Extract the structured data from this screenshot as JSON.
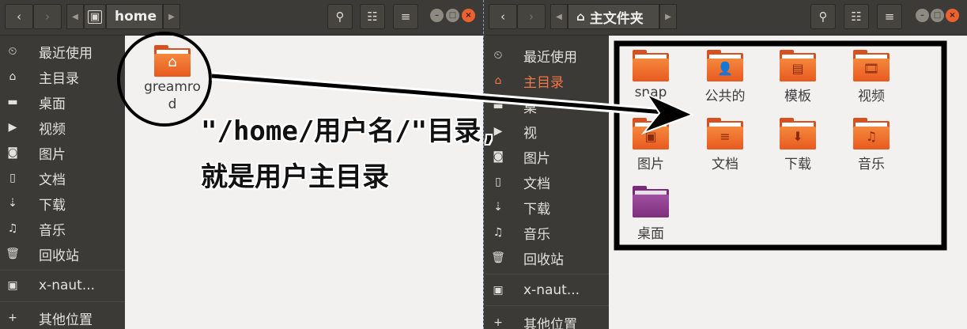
{
  "left_window": {
    "path": {
      "icon": "home-folder-icon",
      "label": "home"
    },
    "sidebar": [
      {
        "icon": "clock-icon",
        "glyph": "⏲",
        "label": "最近使用"
      },
      {
        "icon": "home-icon",
        "glyph": "⌂",
        "label": "主目录"
      },
      {
        "icon": "folder-icon",
        "glyph": "▬",
        "label": "桌面"
      },
      {
        "icon": "video-icon",
        "glyph": "▶",
        "label": "视频"
      },
      {
        "icon": "camera-icon",
        "glyph": "◙",
        "label": "图片"
      },
      {
        "icon": "document-icon",
        "glyph": "▯",
        "label": "文档"
      },
      {
        "icon": "download-icon",
        "glyph": "⇣",
        "label": "下载"
      },
      {
        "icon": "music-icon",
        "glyph": "♫",
        "label": "音乐"
      },
      {
        "icon": "trash-icon",
        "glyph": "🗑",
        "label": "回收站"
      },
      {
        "icon": "network-drive-icon",
        "glyph": "▣",
        "label": "x-naut..."
      },
      {
        "icon": "plus-icon",
        "glyph": "+",
        "label": "其他位置"
      }
    ],
    "items": [
      {
        "label_line1": "greamro",
        "label_line2": "d"
      }
    ]
  },
  "right_window": {
    "path": {
      "icon": "home-icon",
      "label": "主文件夹"
    },
    "sidebar": [
      {
        "icon": "clock-icon",
        "glyph": "⏲",
        "label": "最近使用"
      },
      {
        "icon": "home-icon",
        "glyph": "⌂",
        "label": "主目录",
        "active": true
      },
      {
        "icon": "folder-icon",
        "glyph": "▬",
        "label": "桌"
      },
      {
        "icon": "video-icon",
        "glyph": "▶",
        "label": "视"
      },
      {
        "icon": "camera-icon",
        "glyph": "◙",
        "label": "图片"
      },
      {
        "icon": "document-icon",
        "glyph": "▯",
        "label": "文档"
      },
      {
        "icon": "download-icon",
        "glyph": "⇣",
        "label": "下载"
      },
      {
        "icon": "music-icon",
        "glyph": "♫",
        "label": "音乐"
      },
      {
        "icon": "trash-icon",
        "glyph": "🗑",
        "label": "回收站"
      },
      {
        "icon": "network-drive-icon",
        "glyph": "▣",
        "label": "x-naut..."
      },
      {
        "icon": "plus-icon",
        "glyph": "+",
        "label": "其他位置"
      }
    ],
    "items": [
      {
        "label": "snap",
        "emblem": ""
      },
      {
        "label": "公共的",
        "emblem": "👤"
      },
      {
        "label": "模板",
        "emblem": "▤"
      },
      {
        "label": "视频",
        "emblem": "🎞"
      },
      {
        "label": "图片",
        "emblem": "▣"
      },
      {
        "label": "文档",
        "emblem": "≡"
      },
      {
        "label": "下载",
        "emblem": "⬇"
      },
      {
        "label": "音乐",
        "emblem": "♫"
      },
      {
        "label": "桌面",
        "emblem": ""
      }
    ]
  },
  "annotation": {
    "line1": "\"/home/用户名/\"目录,",
    "line2": "就是用户主目录"
  },
  "colors": {
    "accent": "#e95420",
    "header_bg": "#3c3b37",
    "sidebar_bg": "#3b3a36",
    "content_bg": "#f2f1f0"
  }
}
